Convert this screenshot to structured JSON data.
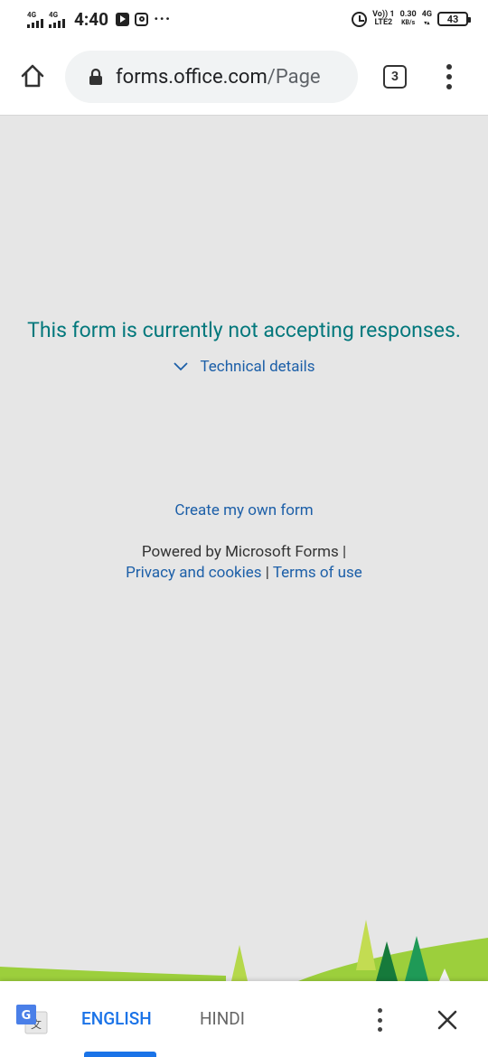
{
  "status_bar": {
    "net1": "4G",
    "net2": "4G",
    "time": "4:40",
    "volte_top": "Vo)) 1",
    "volte_bottom": "LTE2",
    "speed_value": "0.30",
    "speed_unit": "KB/s",
    "net3": "4G",
    "battery": "43"
  },
  "browser": {
    "url_host": "forms.office.com",
    "url_path": "/Page",
    "tab_count": "3"
  },
  "content": {
    "message": "This form is currently not accepting responses.",
    "technical_details": "Technical details",
    "create_form": "Create my own form",
    "powered_by": "Powered by Microsoft Forms |",
    "privacy": "Privacy and cookies",
    "separator": "|",
    "terms": "Terms of use"
  },
  "translate_bar": {
    "source_lang": "ENGLISH",
    "target_lang": "HINDI"
  },
  "colors": {
    "message_green": "#03787c",
    "link_blue": "#1c5fa8",
    "active_lang_blue": "#1a73e8"
  }
}
